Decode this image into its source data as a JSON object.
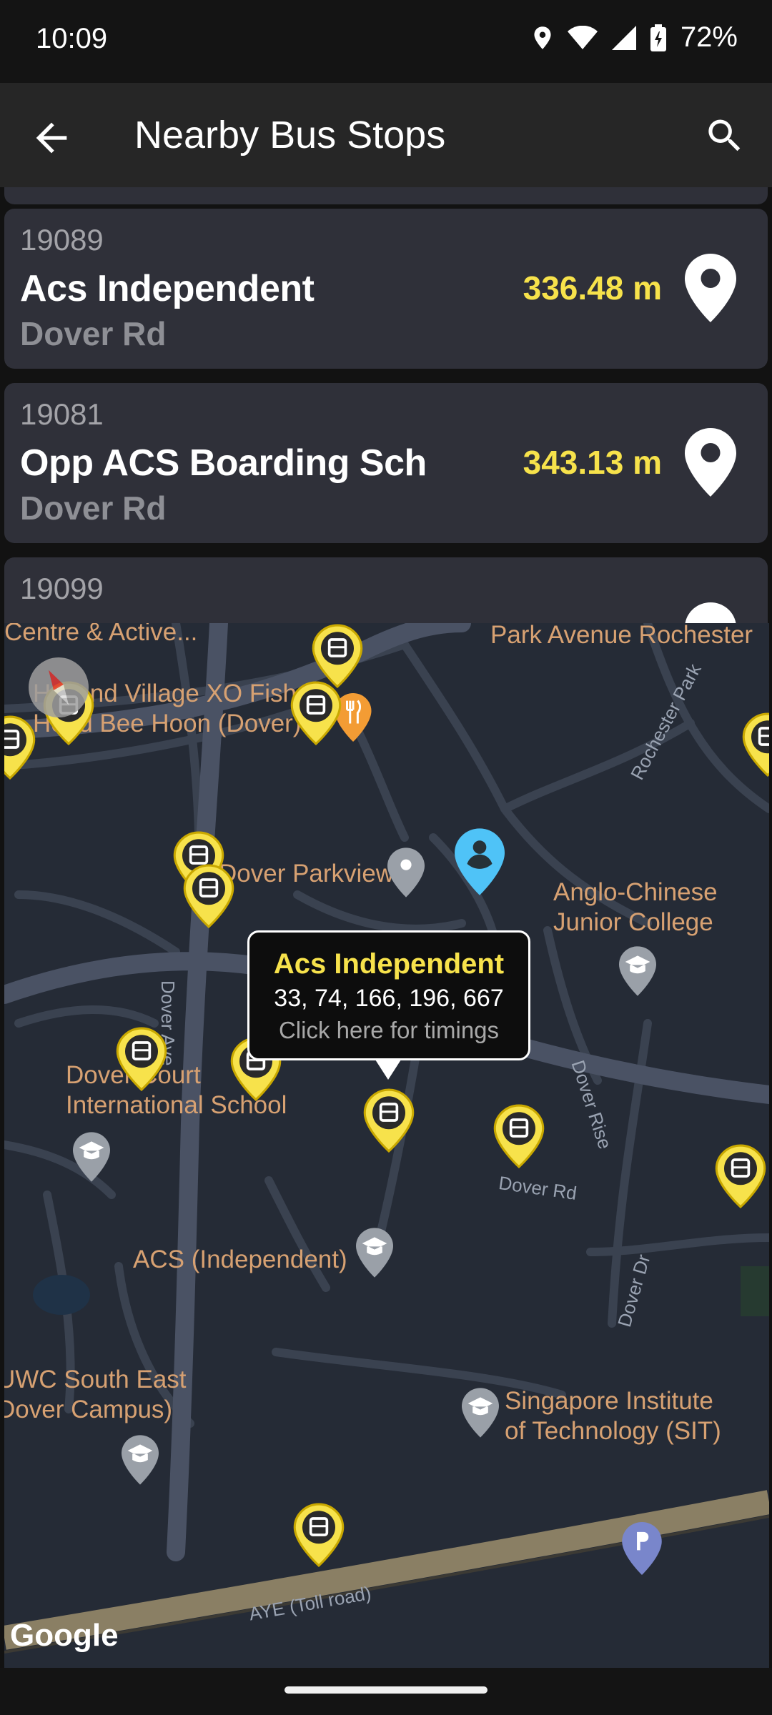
{
  "status": {
    "time": "10:09",
    "battery": "72%"
  },
  "app": {
    "title": "Nearby Bus Stops"
  },
  "stops": [
    {
      "code": "19089",
      "name": "Acs Independent",
      "road": "Dover Rd",
      "distance": "336.48 m"
    },
    {
      "code": "19081",
      "name": "Opp ACS Boarding Sch",
      "road": "Dover Rd",
      "distance": "343.13 m"
    },
    {
      "code": "19099"
    }
  ],
  "map": {
    "places": {
      "p1": "Centre & Active...",
      "p2": "Park Avenue Rochester",
      "p3": "Holland Village XO Fish\nHead Bee Hoon (Dover)",
      "p4": "Dover Parkview",
      "p5": "Anglo-Chinese\nJunior College",
      "p6": "Dover Court\nInternational School",
      "p7": "ACS (Independent)",
      "p8": "UWC South East\nDover Campus)",
      "p9": "Singapore Institute\nof Technology (SIT)"
    },
    "roads": {
      "r1": "Rochester Park",
      "r2": "Dover Ave",
      "r3": "Dover Rise",
      "r4": "Dover Rd",
      "r5": "Dover Dr",
      "r6": "AYE (Toll road)"
    },
    "callout": {
      "title": "Acs Independent",
      "services": "33, 74, 166, 196, 667",
      "hint": "Click here for timings"
    },
    "attribution": "Google"
  },
  "colors": {
    "accent": "#f7e24b",
    "card": "#2f3039",
    "map_bg": "#252b36",
    "user_pin": "#4fc3f7",
    "label": "#d7a172"
  }
}
